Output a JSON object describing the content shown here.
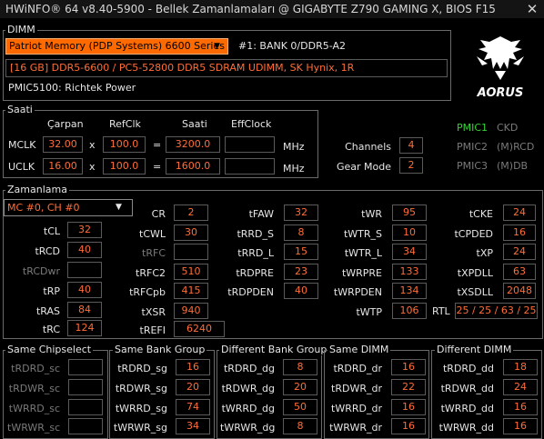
{
  "window": {
    "title": "HWiNFO® 64 v8.40-5900 - Bellek Zamanlamaları @ GIGABYTE Z790 GAMING X, BIOS F15",
    "close": "✕"
  },
  "dimm": {
    "group_label": "DIMM",
    "module_select": "Patriot Memory (PDP Systems) 6600 Series",
    "bank": "#1: BANK 0/DDR5-A2",
    "description": "[16 GB] DDR5-6600 / PC5-52800 DDR5 SDRAM UDIMM, SK Hynix, 1R",
    "pmic": "PMIC5100: Richtek Power",
    "logo_text": "AORUS"
  },
  "clock": {
    "group_label": "Saati",
    "col_multiplier": "Çarpan",
    "col_refclk": "RefClk",
    "col_clock": "Saati",
    "col_effclock": "EffClock",
    "mclk": {
      "label": "MCLK",
      "multiplier": "32.00",
      "refclk": "100.0",
      "value": "3200.0",
      "eff": "",
      "unit": "MHz"
    },
    "uclk": {
      "label": "UCLK",
      "multiplier": "16.00",
      "refclk": "100.0",
      "value": "1600.0",
      "eff": "",
      "unit": "MHz"
    },
    "times": "x",
    "equals": "=",
    "channels_label": "Channels",
    "channels": "4",
    "gear_label": "Gear Mode",
    "gear": "2"
  },
  "pmic_status": [
    {
      "name": "PMIC1",
      "value": "CKD",
      "active": true
    },
    {
      "name": "PMIC2",
      "value": "(M)RCD",
      "active": false
    },
    {
      "name": "PMIC3",
      "value": "(M)DB",
      "active": false
    }
  ],
  "timings": {
    "group_label": "Zamanlama",
    "controller_select": "MC #0, CH #0",
    "tCL": "32",
    "tRCD": "40",
    "tRCDwr": "",
    "tRP": "40",
    "tRAS": "84",
    "tRC": "124",
    "CR": "2",
    "tCWL": "30",
    "tRFC": "",
    "tRFC2": "510",
    "tRFCpb": "415",
    "tXSR": "940",
    "tREFI": "6240",
    "tFAW": "32",
    "tRRD_S": "8",
    "tRRD_L": "15",
    "tRDPRE": "23",
    "tRDPDEN": "40",
    "tWR": "95",
    "tWTR_S": "10",
    "tWTR_L": "34",
    "tWRPRE": "133",
    "tWRPDEN": "134",
    "tWTP": "106",
    "tCKE": "24",
    "tCPDED": "16",
    "tXP": "24",
    "tXPDLL": "63",
    "tXSDLL": "2048",
    "RTL_label": "RTL",
    "RTL": "25 / 25 / 63 / 25"
  },
  "turnaround": {
    "same_chipselect": {
      "label": "Same Chipselect",
      "rows": [
        {
          "name": "tRDRD_sc",
          "value": ""
        },
        {
          "name": "tRDWR_sc",
          "value": ""
        },
        {
          "name": "tWRRD_sc",
          "value": ""
        },
        {
          "name": "tWRWR_sc",
          "value": ""
        }
      ]
    },
    "same_bank_group": {
      "label": "Same Bank Group",
      "rows": [
        {
          "name": "tRDRD_sg",
          "value": "16"
        },
        {
          "name": "tRDWR_sg",
          "value": "20"
        },
        {
          "name": "tWRRD_sg",
          "value": "74"
        },
        {
          "name": "tWRWR_sg",
          "value": "34"
        }
      ]
    },
    "different_bank_group": {
      "label": "Different Bank Group",
      "rows": [
        {
          "name": "tRDRD_dg",
          "value": "8"
        },
        {
          "name": "tRDWR_dg",
          "value": "20"
        },
        {
          "name": "tWRRD_dg",
          "value": "50"
        },
        {
          "name": "tWRWR_dg",
          "value": "8"
        }
      ]
    },
    "same_dimm": {
      "label": "Same DIMM",
      "rows": [
        {
          "name": "tRDRD_dr",
          "value": "16"
        },
        {
          "name": "tRDWR_dr",
          "value": "22"
        },
        {
          "name": "tWRRD_dr",
          "value": "16"
        },
        {
          "name": "tWRWR_dr",
          "value": "16"
        }
      ]
    },
    "different_dimm": {
      "label": "Different DIMM",
      "rows": [
        {
          "name": "tRDRD_dd",
          "value": "18"
        },
        {
          "name": "tRDWR_dd",
          "value": "24"
        },
        {
          "name": "tWRRD_dd",
          "value": "16"
        },
        {
          "name": "tWRWR_dd",
          "value": "16"
        }
      ]
    }
  },
  "colors": {
    "accent": "#ff6a00",
    "value": "#ff6d38",
    "active": "#36d336",
    "dim": "#7a7a7a"
  }
}
